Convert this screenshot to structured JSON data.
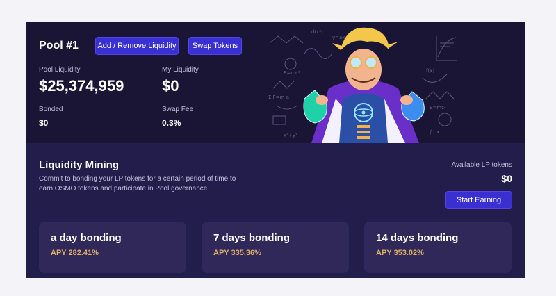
{
  "pool": {
    "title": "Pool #1",
    "add_remove_label": "Add / Remove Liquidity",
    "swap_label": "Swap Tokens",
    "pool_liquidity_label": "Pool Liquidity",
    "pool_liquidity_value": "$25,374,959",
    "my_liquidity_label": "My Liquidity",
    "my_liquidity_value": "$0",
    "bonded_label": "Bonded",
    "bonded_value": "$0",
    "swap_fee_label": "Swap Fee",
    "swap_fee_value": "0.3%"
  },
  "mining": {
    "title": "Liquidity Mining",
    "description": "Commit to bonding your LP tokens for a certain period of time to earn OSMO tokens and participate in Pool governance",
    "available_label": "Available LP tokens",
    "available_value": "$0",
    "start_label": "Start Earning",
    "cards": [
      {
        "title": "a day bonding",
        "apy": "APY 282.41%"
      },
      {
        "title": "7 days bonding",
        "apy": "APY 335.36%"
      },
      {
        "title": "14 days bonding",
        "apy": "APY 353.02%"
      }
    ]
  },
  "colors": {
    "accent": "#3a2fd0",
    "apy": "#e0b068",
    "hero_bg": "#1a1535",
    "section_bg": "#231d4b",
    "card_bg": "#2f2859"
  },
  "icons": [
    "scientist-illustration"
  ]
}
